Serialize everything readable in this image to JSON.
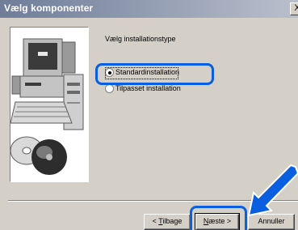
{
  "window": {
    "title": "Vælg komponenter",
    "close_glyph": "X"
  },
  "content": {
    "heading": "Vælg installationstype",
    "options": [
      {
        "label": "Standardinstallation",
        "selected": true
      },
      {
        "label": "Tilpasset installation",
        "selected": false
      }
    ]
  },
  "buttons": {
    "back_rest": "ilbage",
    "back_mnemonic": "T",
    "back_prefix": "<",
    "next_mnemonic": "N",
    "next_rest": "æste >",
    "cancel": "Annuller"
  },
  "annotations": {
    "highlight_color": "#0a5fe0"
  },
  "icons": {
    "illustration": "computer-and-cd-illustration",
    "arrow": "pointer-arrow-icon"
  }
}
